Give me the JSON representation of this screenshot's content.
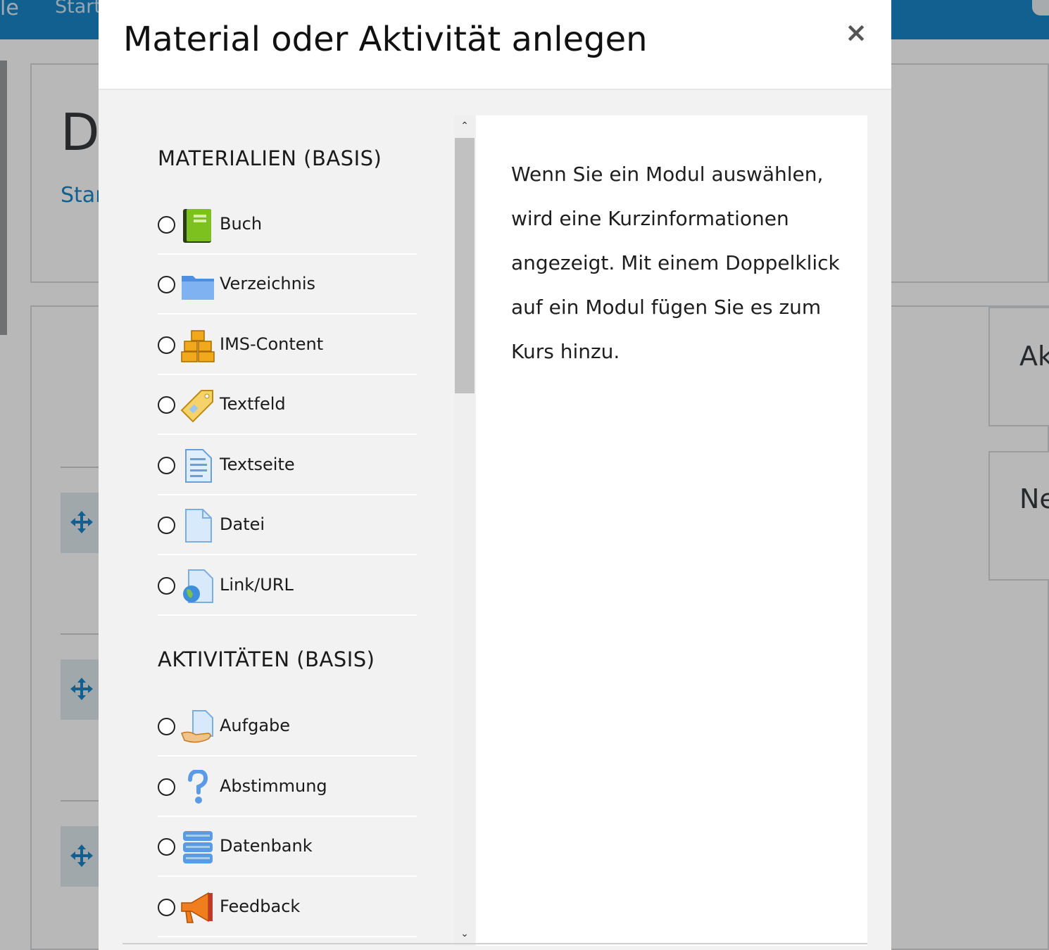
{
  "background": {
    "brand_text": "le",
    "nav_home": "Start",
    "page_heading_fragment": "D",
    "breadcrumb_fragment": "Star",
    "side_card_1": "Ak",
    "side_card_2": "Ne"
  },
  "modal": {
    "title": "Material oder Aktivität anlegen",
    "close_symbol": "×",
    "info_text": "Wenn Sie ein Modul auswählen, wird eine Kurzinformationen angezeigt. Mit einem Doppelklick auf ein Modul fügen Sie es zum Kurs hinzu.",
    "sections": [
      {
        "title": "MATERIALIEN (BASIS)",
        "items": [
          {
            "label": "Buch",
            "icon": "book-icon"
          },
          {
            "label": "Verzeichnis",
            "icon": "folder-icon"
          },
          {
            "label": "IMS-Content",
            "icon": "ims-package-icon"
          },
          {
            "label": "Textfeld",
            "icon": "label-tag-icon"
          },
          {
            "label": "Textseite",
            "icon": "page-icon"
          },
          {
            "label": "Datei",
            "icon": "file-icon"
          },
          {
            "label": "Link/URL",
            "icon": "url-globe-icon"
          }
        ]
      },
      {
        "title": "AKTIVITÄTEN (BASIS)",
        "items": [
          {
            "label": "Aufgabe",
            "icon": "assignment-icon"
          },
          {
            "label": "Abstimmung",
            "icon": "question-mark-icon"
          },
          {
            "label": "Datenbank",
            "icon": "database-icon"
          },
          {
            "label": "Feedback",
            "icon": "megaphone-icon"
          }
        ]
      }
    ],
    "scroll_up": "⌃",
    "scroll_down": "⌄"
  }
}
